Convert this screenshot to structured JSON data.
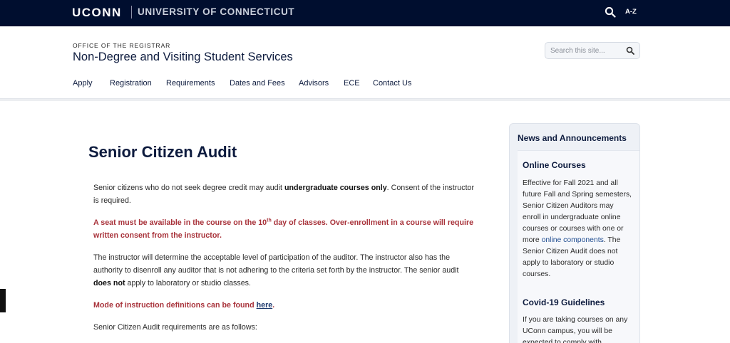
{
  "topbar": {
    "brand": "UCONN",
    "university": "UNIVERSITY OF CONNECTICUT",
    "search_icon": "search-icon",
    "az_label": "A-Z",
    "bg_color": "#000e2f"
  },
  "header": {
    "office": "OFFICE OF THE REGISTRAR",
    "title": "Non-Degree and Visiting Student Services",
    "search_placeholder": "Search this site...",
    "search_icon": "search-icon"
  },
  "nav": {
    "items": [
      "Apply",
      "Registration",
      "Requirements",
      "Dates and Fees",
      "Advisors",
      "ECE",
      "Contact Us"
    ]
  },
  "main": {
    "title": "Senior Citizen Audit",
    "p1_a": "Senior citizens who do not seek degree credit may audit ",
    "p1_b": "undergraduate courses only",
    "p1_c": ". Consent of the instructor is required.",
    "p2_a": "A seat must be available in the course on the 10",
    "p2_sup": "th",
    "p2_b": " day of classes. Over-enrollment in a course will require written consent from the instructor.",
    "p3_a": "The instructor will determine the acceptable level of participation of the auditor. The instructor also has the authority to disenroll any auditor that is not adhering to the criteria set forth by the instructor. The senior audit ",
    "p3_b": "does not",
    "p3_c": " apply to laboratory or studio classes.",
    "p4_a": "Mode of instruction definitions can be found ",
    "p4_link": "here",
    "p4_b": ".",
    "p5": "Senior Citizen Audit requirements are as follows:"
  },
  "sidebar": {
    "heading": "News and Announcements",
    "item1_title": "Online Courses",
    "item1_text_a": "Effective for Fall 2021 and all future Fall and Spring semesters, Senior Citizen Auditors may enroll in undergraduate online courses or courses with one or more ",
    "item1_link": "online components",
    "item1_text_b": ". The Senior Citizen Audit does not apply to laboratory or studio courses.",
    "item2_title": "Covid-19 Guidelines",
    "item2_text": "If you are taking courses on any UConn campus, you will be expected to comply with"
  }
}
